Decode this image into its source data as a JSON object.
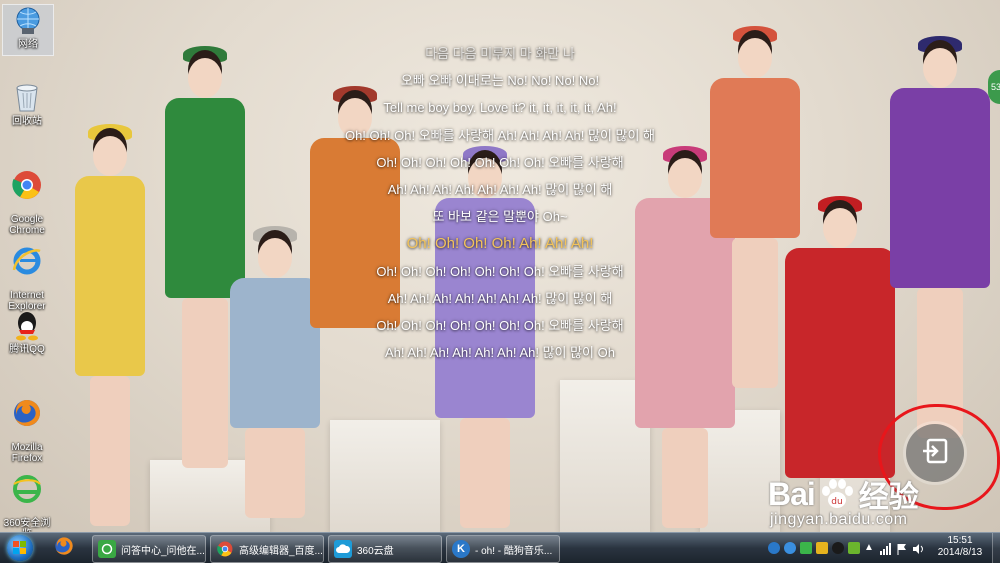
{
  "desktop": {
    "icons": [
      {
        "label": "网络",
        "icon": "network-icon"
      },
      {
        "label": "回收站",
        "icon": "recycle-bin-icon"
      },
      {
        "label": "Google\nChrome",
        "icon": "chrome-icon"
      },
      {
        "label": "Internet\nExplorer",
        "icon": "ie-icon"
      },
      {
        "label": "腾讯QQ",
        "icon": "qq-icon"
      },
      {
        "label": "Mozilla\nFirefox",
        "icon": "firefox-icon"
      },
      {
        "label": "360安全浏览\n器7",
        "icon": "360-browser-icon"
      }
    ]
  },
  "lyrics": {
    "lines": [
      "다음 다음 미루지 마 화만 나",
      "오빠 오빠 이대로는 No! No! No! No!",
      "Tell me boy boy. Love it? it, it, it, it, it, Ah!",
      "Oh! Oh! Oh! 오빠를 사랑해 Ah! Ah! Ah! Ah! 많이 많이 해",
      "Oh! Oh! Oh! Oh! Oh! Oh! Oh! 오빠를 사랑해",
      "Ah! Ah! Ah! Ah! Ah! Ah! Ah! 많이 많이 해",
      "또 바보 같은 말뿐야 Oh~",
      "Oh! Oh! Oh! Oh! Ah! Ah! Ah!",
      "Oh! Oh! Oh! Oh! Oh! Oh! Oh! 오빠를 사랑해",
      "Ah! Ah! Ah! Ah! Ah! Ah! Ah! 많이 많이 해",
      "Oh! Oh! Oh! Oh! Oh! Oh! Oh! 오빠를 사랑해",
      "Ah! Ah! Ah! Ah! Ah! Ah! Ah! 많이 많이 Oh"
    ],
    "current_index": 7
  },
  "overlay": {
    "float_ball_text": "53",
    "exit_fullscreen_icon": "exit-fullscreen-icon"
  },
  "watermark": {
    "brand_left": "Bai",
    "brand_right": "经验",
    "url": "jingyan.baidu.com"
  },
  "taskbar": {
    "tasks": [
      {
        "label": "问答中心_问他在...",
        "icon": "360-browser-icon",
        "color": "#3aa843"
      },
      {
        "label": "高级编辑器_百度...",
        "icon": "chrome-icon",
        "color": "#e04a2f"
      },
      {
        "label": "360云盘",
        "icon": "cloud-disk-icon",
        "color": "#1e9bd7"
      },
      {
        "label": "- oh! - 酷狗音乐...",
        "icon": "kugou-icon",
        "color": "#2a78c8"
      }
    ],
    "clock_time": "15:51",
    "clock_date": "2014/8/13"
  },
  "colors": {
    "lyric_highlight": "#f3c35a",
    "annotation_red": "#e8161b",
    "taskbar_dark": "#1c242d"
  }
}
